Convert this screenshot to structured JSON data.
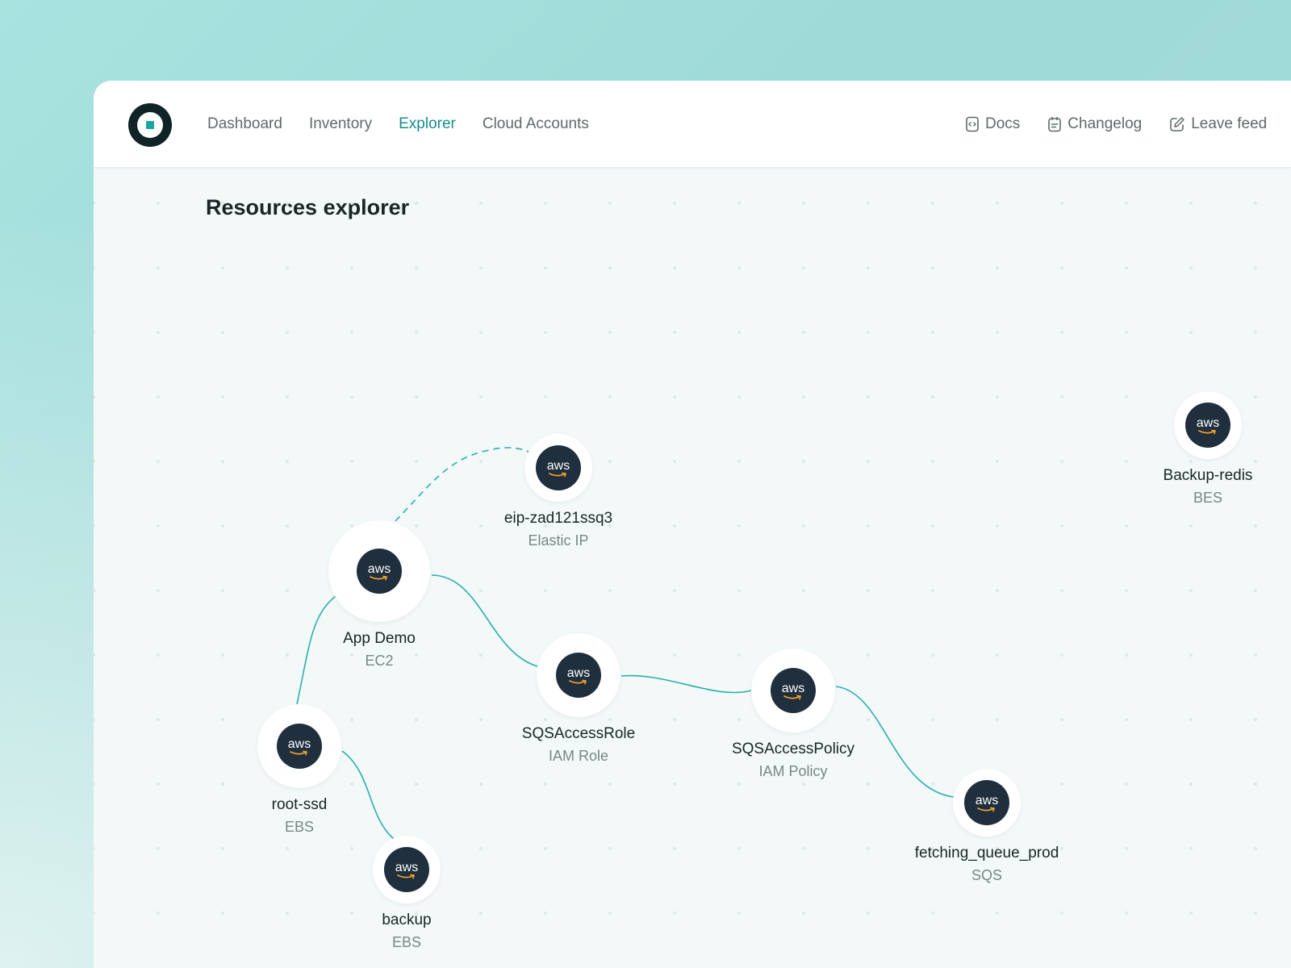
{
  "header": {
    "nav": [
      {
        "label": "Dashboard",
        "active": false
      },
      {
        "label": "Inventory",
        "active": false
      },
      {
        "label": "Explorer",
        "active": true
      },
      {
        "label": "Cloud Accounts",
        "active": false
      }
    ],
    "links": [
      {
        "label": "Docs",
        "icon": "docs-icon"
      },
      {
        "label": "Changelog",
        "icon": "changelog-icon"
      },
      {
        "label": "Leave feed",
        "icon": "edit-icon"
      }
    ]
  },
  "page": {
    "title": "Resources explorer"
  },
  "nodes": [
    {
      "id": "app-demo",
      "name": "App Demo",
      "type": "EC2",
      "provider": "aws"
    },
    {
      "id": "eip",
      "name": "eip-zad121ssq3",
      "type": "Elastic IP",
      "provider": "aws"
    },
    {
      "id": "root-ssd",
      "name": "root-ssd",
      "type": "EBS",
      "provider": "aws"
    },
    {
      "id": "backup",
      "name": "backup",
      "type": "EBS",
      "provider": "aws"
    },
    {
      "id": "sqs-role",
      "name": "SQSAccessRole",
      "type": "IAM Role",
      "provider": "aws"
    },
    {
      "id": "sqs-policy",
      "name": "SQSAccessPolicy",
      "type": "IAM Policy",
      "provider": "aws"
    },
    {
      "id": "queue",
      "name": "fetching_queue_prod",
      "type": "SQS",
      "provider": "aws"
    },
    {
      "id": "backup-redis",
      "name": "Backup-redis",
      "type": "BES",
      "provider": "aws"
    }
  ],
  "edges": [
    {
      "from": "app-demo",
      "to": "eip",
      "style": "dashed"
    },
    {
      "from": "app-demo",
      "to": "root-ssd",
      "style": "solid"
    },
    {
      "from": "root-ssd",
      "to": "backup",
      "style": "solid"
    },
    {
      "from": "app-demo",
      "to": "sqs-role",
      "style": "solid"
    },
    {
      "from": "sqs-role",
      "to": "sqs-policy",
      "style": "solid"
    },
    {
      "from": "sqs-policy",
      "to": "queue",
      "style": "solid"
    }
  ],
  "colors": {
    "accent": "#158f8a",
    "edge": "#2bb0ac",
    "aws_badge": "#1f2f3d",
    "aws_smile": "#f0a030"
  }
}
